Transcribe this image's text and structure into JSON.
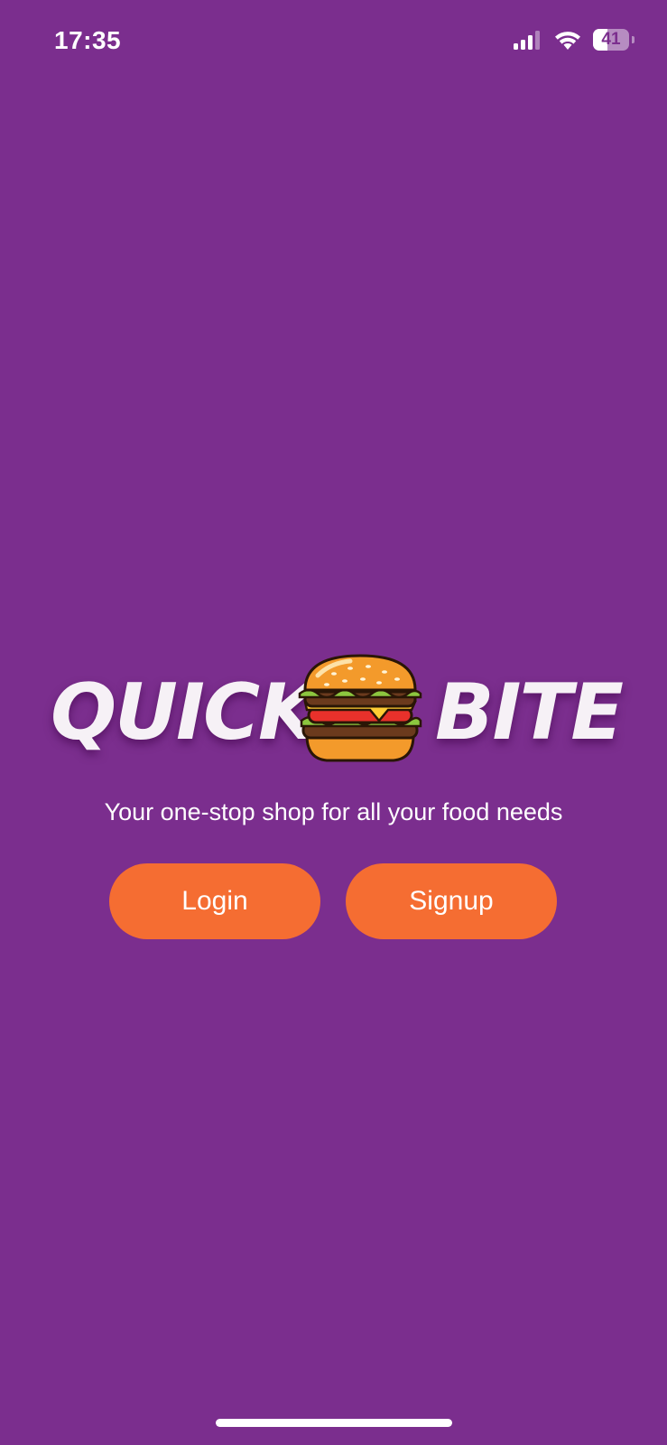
{
  "status_bar": {
    "time": "17:35",
    "battery_level": "41",
    "battery_fraction": 0.41,
    "icons": [
      "signal-icon",
      "wifi-icon",
      "battery-icon"
    ]
  },
  "logo": {
    "word_left": "QUICK",
    "word_right": "BITE",
    "icon": "burger-icon"
  },
  "tagline": "Your one-stop shop for all your food needs",
  "buttons": {
    "login": "Login",
    "signup": "Signup"
  },
  "colors": {
    "background": "#7b2e8e",
    "button": "#f56d32",
    "text": "#ffffff"
  }
}
